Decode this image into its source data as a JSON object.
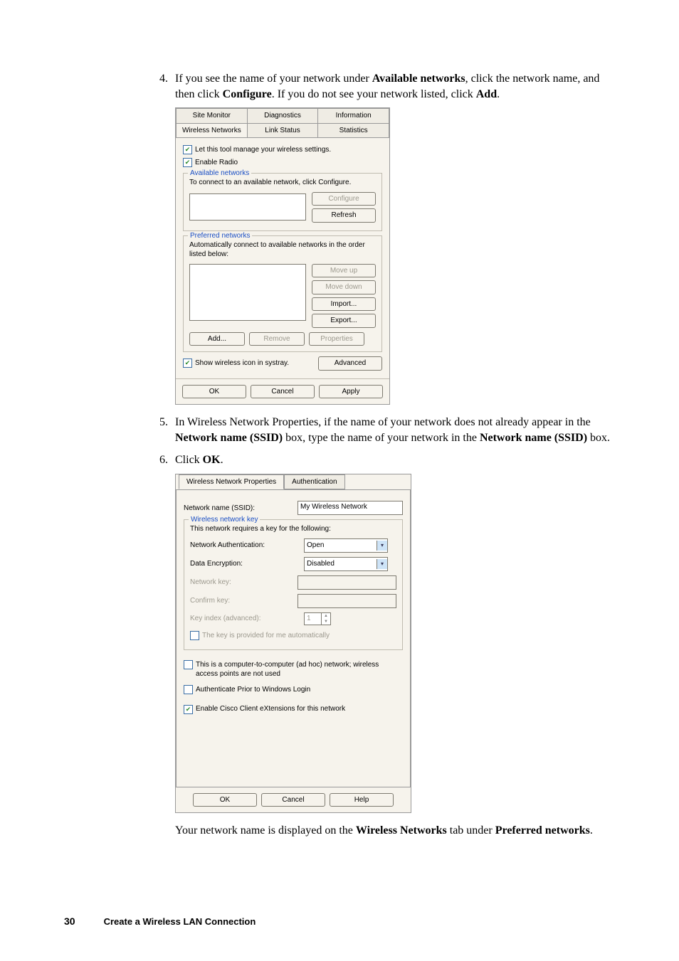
{
  "steps": {
    "s4": {
      "prefix": "If you see the name of your network under ",
      "b1": "Available networks",
      "mid1": ", click the network name, and then click ",
      "b2": "Configure",
      "mid2": ". If you do not see your network listed, click ",
      "b3": "Add",
      "suffix": "."
    },
    "s5": {
      "prefix": "In Wireless Network Properties, if the name of your network does not already appear in the ",
      "b1": "Network name (SSID)",
      "mid1": " box, type the name of your network in the ",
      "b2": "Network name (SSID)",
      "suffix": " box."
    },
    "s6": {
      "prefix": "Click ",
      "b1": "OK",
      "suffix": "."
    }
  },
  "dlg1": {
    "tabs_row1": {
      "site_monitor": "Site Monitor",
      "diagnostics": "Diagnostics",
      "information": "Information"
    },
    "tabs_row2": {
      "wireless_networks": "Wireless Networks",
      "link_status": "Link Status",
      "statistics": "Statistics"
    },
    "let_tool": "Let this tool manage your wireless settings.",
    "enable_radio": "Enable Radio",
    "avail_title": "Available networks",
    "avail_text": "To connect to an available network, click Configure.",
    "configure": "Configure",
    "refresh": "Refresh",
    "pref_title": "Preferred networks",
    "pref_text": "Automatically connect to available networks in the order listed below:",
    "move_up": "Move up",
    "move_down": "Move down",
    "import": "Import...",
    "export": "Export...",
    "add": "Add...",
    "remove": "Remove",
    "properties": "Properties",
    "show_systray": "Show wireless icon in systray.",
    "advanced": "Advanced",
    "ok": "OK",
    "cancel": "Cancel",
    "apply": "Apply"
  },
  "dlg2": {
    "tab_props": "Wireless Network Properties",
    "tab_auth": "Authentication",
    "ssid_label": "Network name (SSID):",
    "ssid_value": "My Wireless Network",
    "key_title": "Wireless network key",
    "key_text": "This network requires a key for the following:",
    "auth_label": "Network Authentication:",
    "auth_value": "Open",
    "enc_label": "Data Encryption:",
    "enc_value": "Disabled",
    "netkey_label": "Network key:",
    "confirm_label": "Confirm key:",
    "keyindex_label": "Key index (advanced):",
    "keyindex_value": "1",
    "auto_key": "The key is provided for me automatically",
    "adhoc": "This is a computer-to-computer (ad hoc) network; wireless access points are not used",
    "auth_prior": "Authenticate Prior to Windows Login",
    "cisco": "Enable Cisco Client eXtensions for this network",
    "ok": "OK",
    "cancel": "Cancel",
    "help": "Help"
  },
  "closing_line": {
    "prefix": "Your network name is displayed on the ",
    "b1": "Wireless Networks",
    "mid": " tab under ",
    "b2": "Preferred networks",
    "suffix": "."
  },
  "footer": {
    "page": "30",
    "chapter": "Create a Wireless LAN Connection"
  }
}
